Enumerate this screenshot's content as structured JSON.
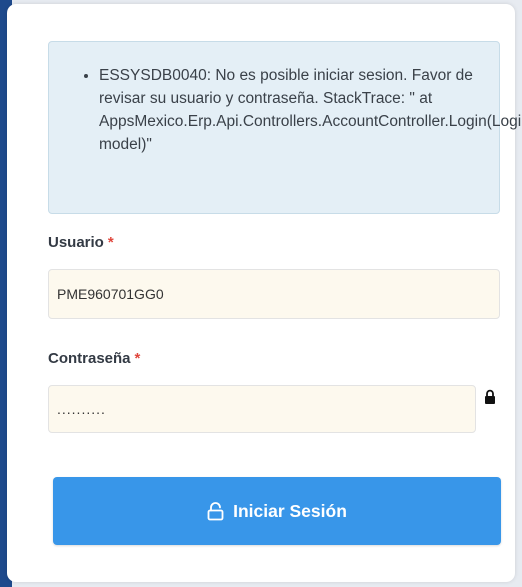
{
  "alert": {
    "messages": [
      "ESSYSDB0040: No es posible iniciar sesion. Favor de revisar su usuario y contraseña. StackTrace: \" at AppsMexico.Erp.Api.Controllers.AccountController.Login(Login model)\""
    ]
  },
  "form": {
    "username": {
      "label": "Usuario",
      "required_mark": "*",
      "value": "PME960701GG0"
    },
    "password": {
      "label": "Contraseña",
      "required_mark": "*",
      "value": "..........",
      "icon": "lock-icon"
    },
    "submit": {
      "label": "Iniciar Sesión",
      "icon": "unlock-icon"
    }
  },
  "colors": {
    "accent": "#3896e9",
    "required": "#e0463c",
    "alert_bg": "#e4eff6",
    "input_bg": "#fdf9ee"
  }
}
